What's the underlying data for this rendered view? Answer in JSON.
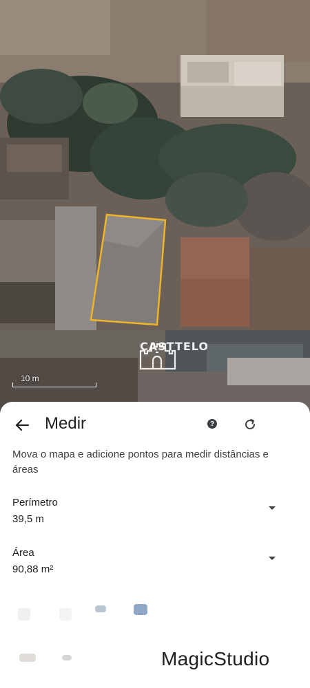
{
  "map": {
    "scale_label": "10 m",
    "logo_text": "CASTTELO"
  },
  "sheet": {
    "title": "Medir",
    "instructions": "Mova o mapa e adicione pontos para medir distâncias e áreas",
    "perimeter_label": "Perímetro",
    "perimeter_value": "39,5 m",
    "area_label": "Área",
    "area_value": "90,88 m²"
  },
  "watermark": "MagicStudio",
  "colors": {
    "measure_outline": "#f0b429",
    "sheet_background": "#ffffff",
    "text_primary": "#202124"
  },
  "icons": {
    "back": "arrow-left-icon",
    "help": "help-circle-icon",
    "reset": "refresh-icon"
  }
}
